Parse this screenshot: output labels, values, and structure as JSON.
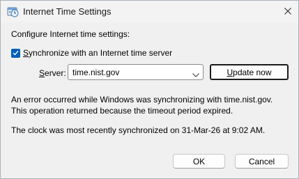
{
  "window": {
    "title": "Internet Time Settings",
    "close_icon": "close-icon"
  },
  "content": {
    "heading": "Configure Internet time settings:",
    "sync_checkbox": {
      "checked": true,
      "label_first": "S",
      "label_rest": "ynchronize with an Internet time server"
    },
    "server": {
      "label_first": "S",
      "label_rest": "erver:",
      "value": "time.nist.gov"
    },
    "update_button": {
      "label_first": "U",
      "label_rest": "pdate now"
    },
    "error_line1": "An error occurred while Windows was synchronizing with time.nist.gov.",
    "error_line2": "This operation returned because the timeout period expired.",
    "last_sync": "The clock was most recently synchronized on 31-Mar-26 at 9:02 AM."
  },
  "buttons": {
    "ok": "OK",
    "cancel": "Cancel"
  },
  "colors": {
    "accent": "#005fb8"
  }
}
